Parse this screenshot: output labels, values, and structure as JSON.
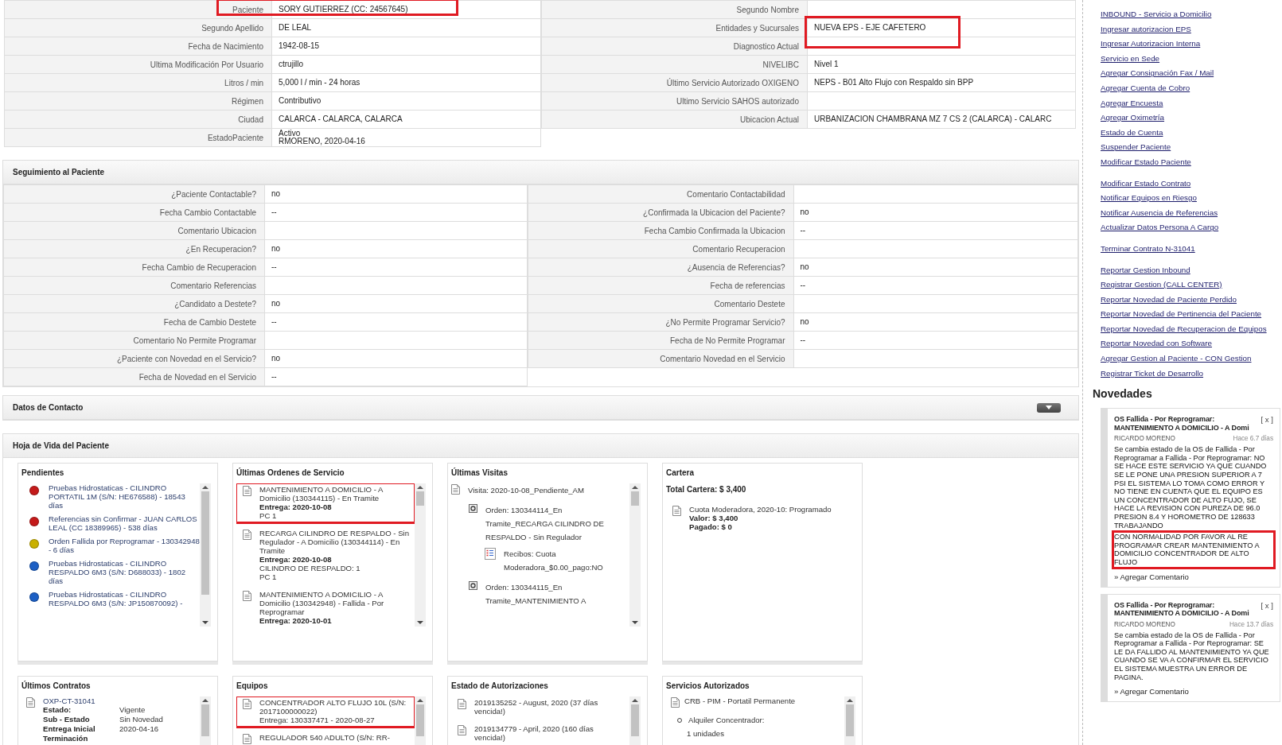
{
  "patient_info": {
    "left": [
      {
        "label": "Paciente",
        "value": "SORY GUTIERREZ (CC: 24567645)",
        "highlighted": true
      },
      {
        "label": "Segundo Apellido",
        "value": "DE LEAL",
        "highlighted": false
      },
      {
        "label": "Fecha de Nacimiento",
        "value": "1942-08-15",
        "highlighted": false
      },
      {
        "label": "Ultima Modificación Por Usuario",
        "value": "ctrujillo",
        "highlighted": false
      },
      {
        "label": "Litros / min",
        "value": "5,000 l / min - 24 horas",
        "highlighted": false
      },
      {
        "label": "Régimen",
        "value": "Contributivo",
        "highlighted": false
      },
      {
        "label": "Ciudad",
        "value": "CALARCA - CALARCA, CALARCA",
        "highlighted": false
      },
      {
        "label": "EstadoPaciente",
        "value": "Activo\nRMORENO, 2020-04-16",
        "highlighted": false
      }
    ],
    "right": [
      {
        "label": "Segundo Nombre",
        "highlighted": false
      },
      {
        "label": "Entidades y Sucursales",
        "value": "NUEVA EPS - EJE CAFETERO",
        "highlighted": true
      },
      {
        "label": "Diagnostico Actual",
        "highlighted": false
      },
      {
        "label": "NIVELIBC",
        "value": "Nivel 1",
        "highlighted": false
      },
      {
        "label": "Último Servicio Autorizado OXIGENO",
        "value": "NEPS - B01 Alto Flujo con Respaldo sin BPP",
        "highlighted": false
      },
      {
        "label": "Ultimo Servicio SAHOS autorizado",
        "highlighted": false
      },
      {
        "label": "Ubicacion Actual",
        "value": "URBANIZACION CHAMBRANA MZ 7 CS 2 (CALARCA) - CALARC",
        "highlighted": false
      }
    ]
  },
  "seguimiento": {
    "title": "Seguimiento al Paciente",
    "left": [
      {
        "label": "¿Paciente Contactable?",
        "value": "no"
      },
      {
        "label": "Fecha Cambio Contactable",
        "value": "--"
      },
      {
        "label": "Comentario Ubicacion"
      },
      {
        "label": "¿En Recuperacion?",
        "value": "no"
      },
      {
        "label": "Fecha Cambio de Recuperacion",
        "value": "--"
      },
      {
        "label": "Comentario Referencias"
      },
      {
        "label": "¿Candidato a Destete?",
        "value": "no"
      },
      {
        "label": "Fecha de Cambio Destete",
        "value": "--"
      },
      {
        "label": "Comentario No Permite Programar"
      },
      {
        "label": "¿Paciente con Novedad en el Servicio?",
        "value": "no"
      },
      {
        "label": "Fecha de Novedad en el Servicio",
        "value": "--"
      }
    ],
    "right": [
      {
        "label": "Comentario Contactabilidad"
      },
      {
        "label": "¿Confirmada la Ubicacion del Paciente?",
        "value": "no"
      },
      {
        "label": "Fecha Cambio Confirmada la Ubicacion",
        "value": "--"
      },
      {
        "label": "Comentario Recuperacion"
      },
      {
        "label": "¿Ausencia de Referencias?",
        "value": "no"
      },
      {
        "label": "Fecha de referencias",
        "value": "--"
      },
      {
        "label": "Comentario Destete"
      },
      {
        "label": "¿No Permite Programar Servicio?",
        "value": "no"
      },
      {
        "label": "Fecha de No Permite Programar",
        "value": "--"
      },
      {
        "label": "Comentario Novedad en el Servicio"
      }
    ]
  },
  "contacto": {
    "title": "Datos de Contacto",
    "expanded": false
  },
  "hoja_de_vida": {
    "title": "Hoja de Vida del Paciente",
    "panels": [
      {
        "title": "Pendientes",
        "kind": "pending",
        "items": [
          {
            "color": "#c41a1a",
            "text": "Pruebas Hidrostaticas - CILINDRO PORTATIL 1M (S/N: HE676588) - 18543 días"
          },
          {
            "color": "#c41a1a",
            "text": "Referencias sin Confirmar - JUAN CARLOS LEAL (CC 18389965) - 538 días"
          },
          {
            "color": "#c9b000",
            "text": "Orden Fallida por Reprogramar - 130342948 - 6 días"
          },
          {
            "color": "#1c5fc4",
            "text": "Pruebas Hidrostaticas - CILINDRO RESPALDO 6M3 (S/N: D688033) - 1802 días"
          },
          {
            "color": "#1c5fc4",
            "text": "Pruebas Hidrostaticas - CILINDRO RESPALDO 6M3 (S/N: JP150870092) -"
          }
        ]
      },
      {
        "title": "Últimas Ordenes de Servicio",
        "kind": "docs",
        "items": [
          {
            "highlighted": true,
            "lines": [
              {
                "text": "MANTENIMIENTO A DOMICILIO - A Domicilio (130344115) - En Tramite",
                "bold": false
              },
              {
                "text": "Entrega: 2020-10-08",
                "bold": true
              },
              {
                "text": "PC 1",
                "bold": false
              }
            ]
          },
          {
            "highlighted": false,
            "lines": [
              {
                "text": "RECARGA CILINDRO DE RESPALDO - Sin Regulador - A Domicilio (130344114) - En Tramite",
                "bold": false
              },
              {
                "text": "Entrega: 2020-10-08",
                "bold": true
              },
              {
                "text": "CILINDRO DE RESPALDO: 1",
                "bold": false
              },
              {
                "text": "PC 1",
                "bold": false
              }
            ]
          },
          {
            "highlighted": false,
            "lines": [
              {
                "text": "MANTENIMIENTO A DOMICILIO - A Domicilio (130342948) - Fallida - Por Reprogramar",
                "bold": false
              },
              {
                "text": "Entrega: 2020-10-01",
                "bold": true
              }
            ]
          }
        ]
      },
      {
        "title": "Últimas Visitas",
        "kind": "visits",
        "items": [
          {
            "kind": "visit",
            "text": "Visita: 2020-10-08_Pendiente_AM",
            "children": [
              {
                "kind": "order",
                "text": "Orden: 130344114_En Tramite_RECARGA CILINDRO DE RESPALDO - Sin Regulador",
                "children": [
                  {
                    "kind": "receipt",
                    "text": "Recibos: Cuota Moderadora_$0.00_pago:NO"
                  }
                ]
              },
              {
                "kind": "order",
                "text": "Orden: 130344115_En Tramite_MANTENIMIENTO A"
              }
            ]
          }
        ]
      },
      {
        "title": "Cartera",
        "kind": "account",
        "total": "Total Cartera: $ 3,400",
        "items": [
          {
            "highlighted": false,
            "lines": [
              {
                "text": "Cuota Moderadora, 2020-10: Programado",
                "bold": false
              },
              {
                "text": "Valor: $ 3,400",
                "bold": true
              },
              {
                "text": "Pagado: $ 0",
                "bold": true
              }
            ]
          }
        ]
      },
      {
        "title": "Últimos Contratos",
        "kind": "contracts",
        "items": [
          {
            "code": "OXP-CT-31041",
            "fields": [
              {
                "label": "Estado:",
                "value": "Vigente"
              },
              {
                "label": "Sub - Estado",
                "value": "Sin Novedad"
              },
              {
                "label": "Entrega Inicial",
                "value": "2020-04-16"
              },
              {
                "label": "Terminación"
              }
            ]
          }
        ]
      },
      {
        "title": "Equipos",
        "kind": "docs",
        "items": [
          {
            "highlighted": true,
            "lines": [
              {
                "text": "CONCENTRADOR ALTO FLUJO 10L (S/N: 2017100000022)",
                "bold": false
              },
              {
                "text": "Entrega: 130337471 - 2020-08-27",
                "bold": false
              }
            ]
          },
          {
            "highlighted": false,
            "lines": [
              {
                "text": "REGULADOR 540 ADULTO (S/N: RR-",
                "bold": false
              }
            ]
          }
        ]
      },
      {
        "title": "Estado de Autorizaciones",
        "kind": "docs",
        "items": [
          {
            "highlighted": false,
            "lines": [
              {
                "text": "2019135252 - August, 2020 (37 días vencida!)",
                "bold": false
              }
            ]
          },
          {
            "highlighted": false,
            "lines": [
              {
                "text": "2019134779 - April, 2020 (160 días vencida!)",
                "bold": false
              }
            ]
          }
        ]
      },
      {
        "title": "Servicios Autorizados",
        "kind": "services",
        "items": [
          {
            "text": "CRB - PIM - Portatil Permanente",
            "children": [
              {
                "text": "Alquiler Concentrador:",
                "detail": "1 unidades"
              }
            ]
          }
        ]
      }
    ]
  },
  "sidebar": {
    "action_groups": [
      {
        "links": [
          "INBOUND - Servicio a Domicilio",
          "Ingresar autorizacion EPS",
          "Ingresar Autorizacion Interna",
          "Servicio en Sede",
          "Agregar Consignación Fax / Mail",
          "Agregar Cuenta de Cobro",
          "Agregar Encuesta",
          "Agregar Oximetría",
          "Estado de Cuenta",
          "Suspender Paciente",
          "Modificar Estado Paciente"
        ]
      },
      {
        "links": [
          "Modificar Estado Contrato",
          "Notificar Equipos en Riesgo",
          "Notificar Ausencia de Referencias",
          "Actualizar Datos Persona A Cargo"
        ]
      },
      {
        "links": [
          "Terminar Contrato N-31041"
        ]
      },
      {
        "links": [
          "Reportar Gestion Inbound",
          "Registrar Gestion (CALL CENTER)",
          "Reportar Novedad de Paciente Perdido",
          "Reportar Novedad de Pertinencia del Paciente",
          "Reportar Novedad de Recuperacion de Equipos",
          "Reportar Novedad con Software",
          "Agregar Gestion al Paciente - CON Gestion",
          "Registrar Ticket de Desarrollo"
        ]
      }
    ],
    "novedades": {
      "title": "Novedades",
      "items": [
        {
          "title": "OS Fallida - Por Reprogramar: MANTENIMIENTO A DOMICILIO - A Domi",
          "close": "[ x ]",
          "author": "RICARDO MORENO",
          "age": "Hace 6.7 días",
          "body": [
            {
              "text": "Se cambia estado de la OS de Fallida - Por Reprogramar a Fallida - Por Reprogramar: NO SE HACE ESTE SERVICIO YA QUE CUANDO SE LE PONE UNA PRESION SUPERIOR A 7 PSI EL SISTEMA LO TOMA COMO ERROR Y NO TIENE EN CUENTA QUE EL EQUIPO ES UN CONCENTRADOR DE ALTO FUJO, SE HACE LA REVISION CON PUREZA DE 96.0 PRESION 8.4 Y HOROMETRO DE 128633 TRABAJANDO",
              "highlighted": false
            },
            {
              "text": "CON NORMALIDAD POR FAVOR AL RE PROGRAMAR CREAR MANTENIMIENTO A DOMICILIO CONCENTRADOR DE ALTO FLUJO",
              "highlighted": true
            }
          ],
          "link": "» Agregar Comentario"
        },
        {
          "title": "OS Fallida - Por Reprogramar: MANTENIMIENTO A DOMICILIO - A Domi",
          "close": "[ x ]",
          "author": "RICARDO MORENO",
          "age": "Hace 13.7 días",
          "body": [
            {
              "text": "Se cambia estado de la OS de Fallida - Por Reprogramar a Fallida - Por Reprogramar: SE LE DA FALLIDO AL MANTENIMIENTO YA QUE CUANDO SE VA A CONFIRMAR EL SERVICIO EL SISTEMA MUESTRA UN ERROR DE PAGINA.",
              "highlighted": false
            }
          ],
          "link": "» Agregar Comentario"
        }
      ]
    }
  }
}
